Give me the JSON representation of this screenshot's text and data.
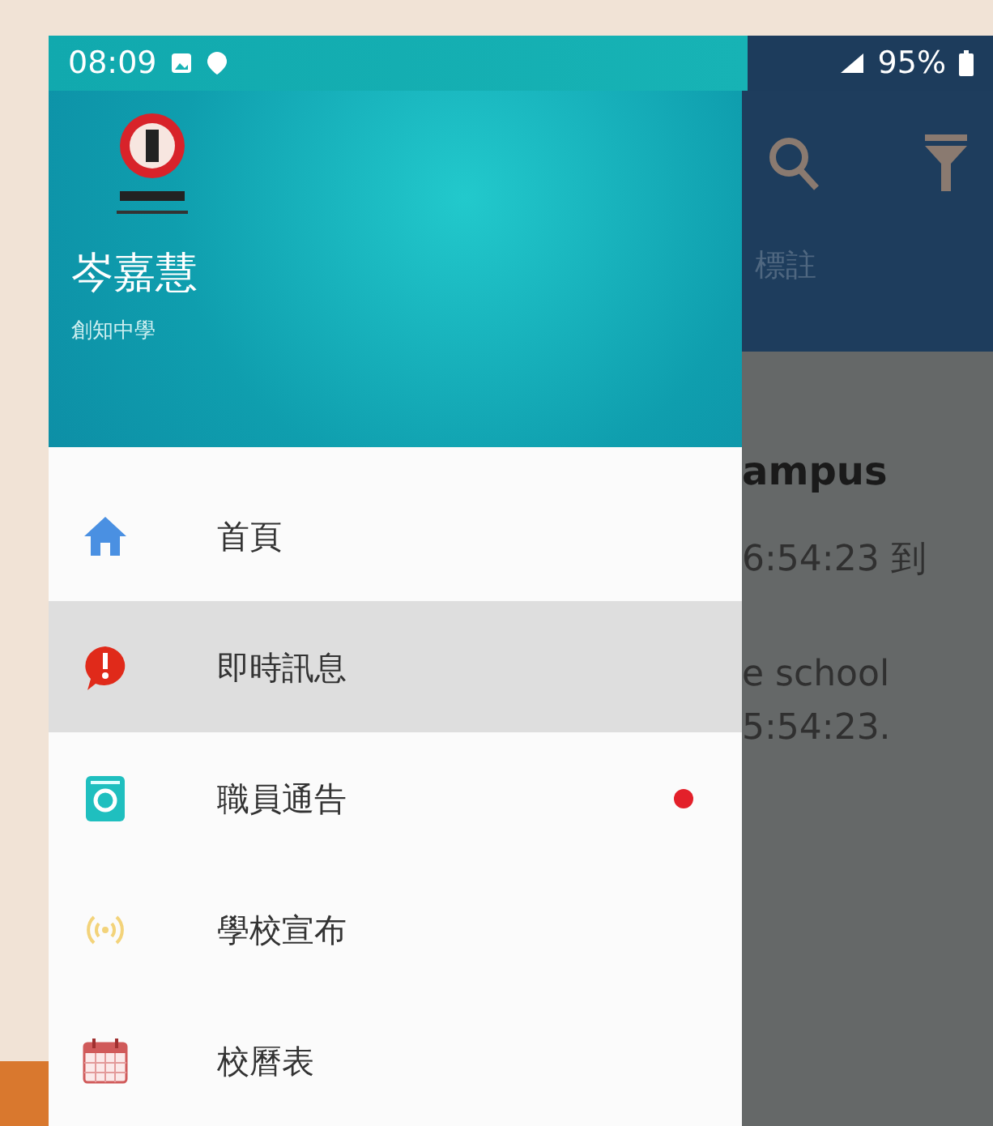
{
  "status_bar": {
    "time": "08:09",
    "battery": "95%"
  },
  "drawer": {
    "header": {
      "user_name": "岑嘉慧",
      "school": "創知中學"
    },
    "items": [
      {
        "kind": "home",
        "label": "首頁",
        "selected": false,
        "unread": false
      },
      {
        "kind": "alert",
        "label": "即時訊息",
        "selected": true,
        "unread": false
      },
      {
        "kind": "notice",
        "label": "職員通告",
        "selected": false,
        "unread": true
      },
      {
        "kind": "broadcast",
        "label": "學校宣布",
        "selected": false,
        "unread": false
      },
      {
        "kind": "calendar",
        "label": "校曆表",
        "selected": false,
        "unread": false
      }
    ]
  },
  "behind": {
    "tab": "標註",
    "title": "ampus",
    "lines": [
      "6:54:23 到",
      "e school",
      "5:54:23."
    ]
  }
}
